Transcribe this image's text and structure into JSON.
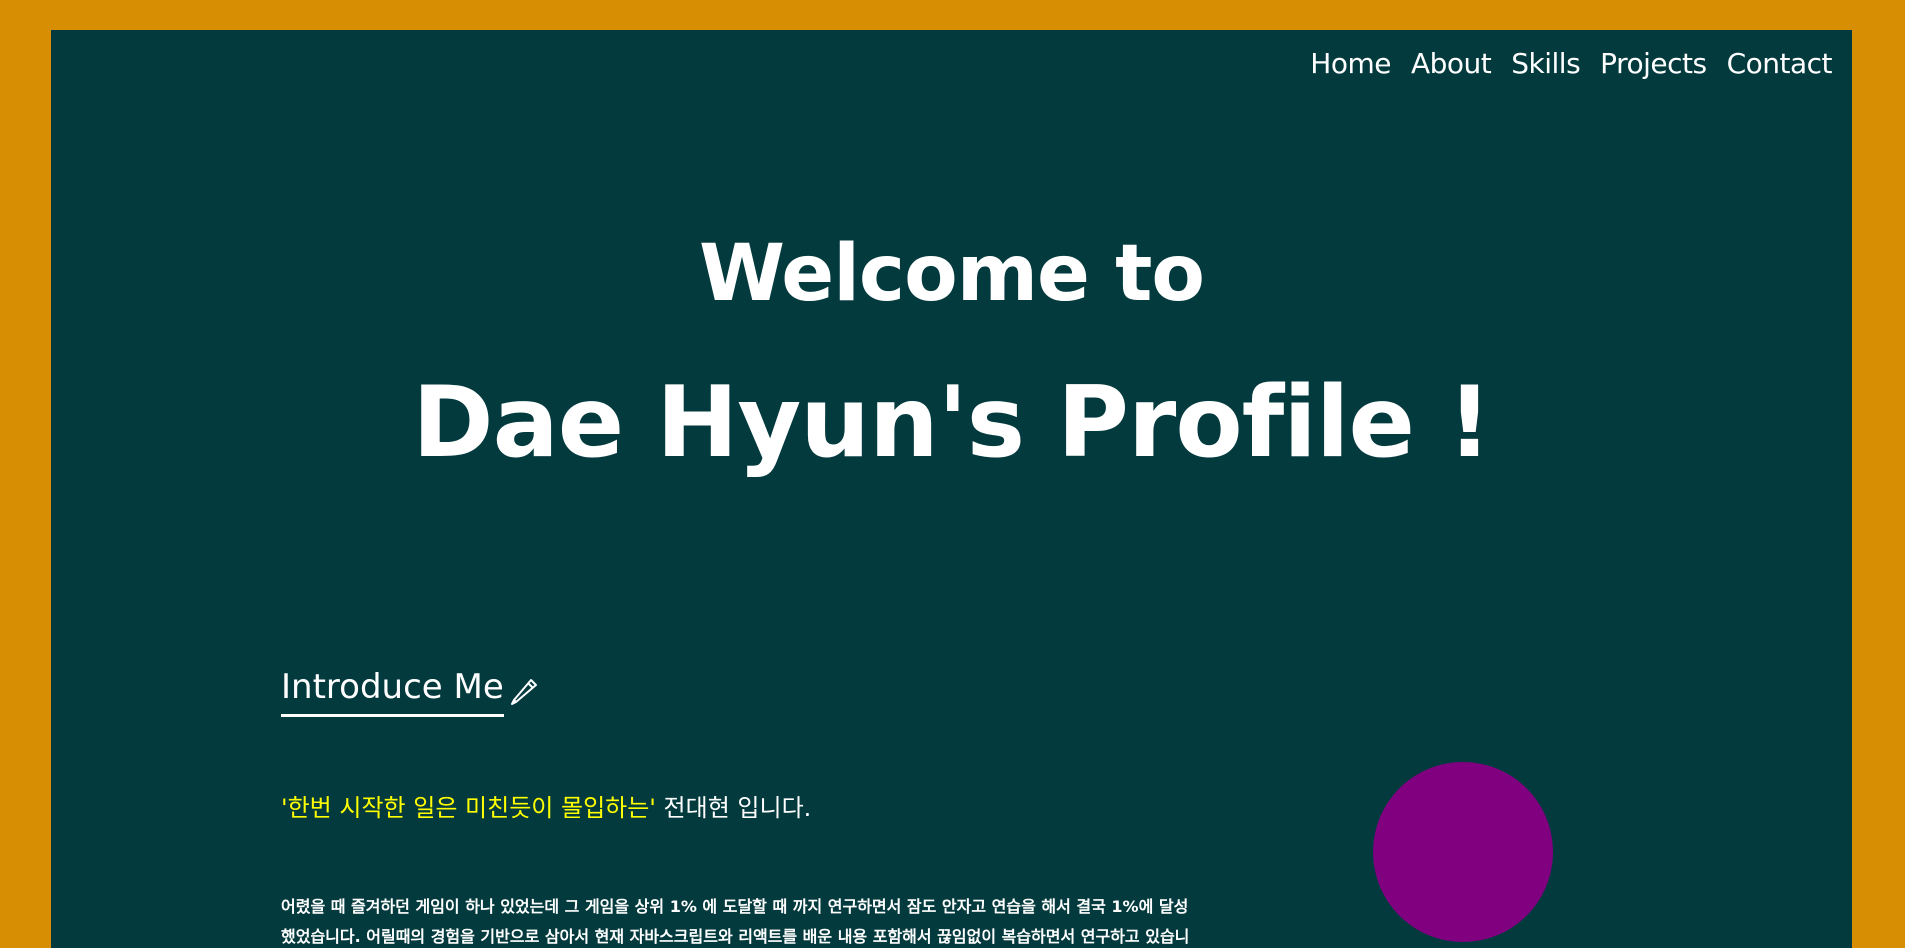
{
  "nav": {
    "items": [
      {
        "label": "Home"
      },
      {
        "label": "About"
      },
      {
        "label": "Skills"
      },
      {
        "label": "Projects"
      },
      {
        "label": "Contact"
      }
    ]
  },
  "hero": {
    "line1": "Welcome to",
    "line2": "Dae Hyun's Profile !"
  },
  "about": {
    "heading": "Introduce Me",
    "heading_icon": "pencil-icon",
    "tagline_highlight": "'한번 시작한 일은 미친듯이 몰입하는'",
    "tagline_rest": " 전대현 입니다.",
    "paragraph": "어렸을 때 즐겨하던 게임이 하나 있었는데 그 게임을 상위 1% 에 도달할 때 까지 연구하면서 잠도 안자고 연습을 해서 결국 1%에 달성했었습니다. 어릴때의 경험을 기반으로 삼아서 현재 자바스크립트와 리액트를 배운 내용 포함해서 끊임없이 복습하면서 연구하고 있습니다. 앞으로도 수없이 변하는 정보에 맞서서 카멜레온 처럼 적응하는 웹 개발자가 되겠습니다."
  },
  "colors": {
    "outer_background": "#d88e03",
    "inner_background": "#033a3e",
    "text": "#ffffff",
    "highlight": "#ffff00",
    "circle": "#800080"
  }
}
